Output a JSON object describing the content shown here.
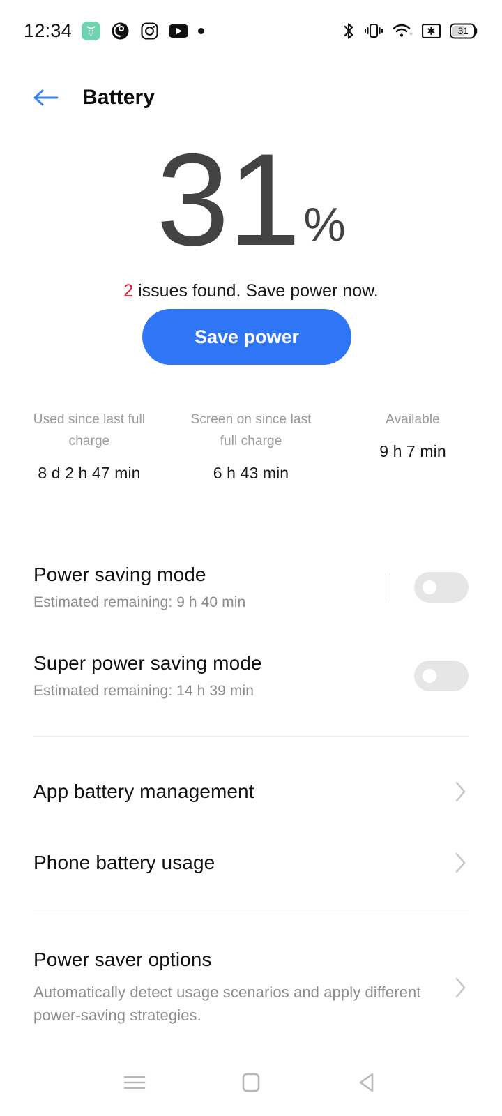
{
  "status_bar": {
    "time": "12:34",
    "left_icons": [
      "green-app-icon",
      "owl-app-icon",
      "instagram-icon",
      "youtube-icon",
      "notification-dot"
    ],
    "right_icons": [
      "bluetooth-icon",
      "vibrate-icon",
      "wifi-icon",
      "screenshot-icon",
      "battery-icon"
    ],
    "battery_level": "31"
  },
  "header": {
    "title": "Battery",
    "back_icon": "arrow-left-icon",
    "back_color": "#3b82f6"
  },
  "battery": {
    "percent": "31",
    "percent_sign": "%",
    "issues_count": "2",
    "issues_text": " issues found. Save power now.",
    "issues_count_color": "#e0203c",
    "save_button_label": "Save power",
    "save_button_color": "#2f76f6"
  },
  "stats": [
    {
      "label": "Used since last full charge",
      "value": "8 d 2 h 47 min"
    },
    {
      "label": "Screen on since last full charge",
      "value": "6 h 43 min"
    },
    {
      "label": "Available",
      "value": "9 h 7 min"
    }
  ],
  "toggles": [
    {
      "title": "Power saving mode",
      "subtitle": "Estimated remaining:  9 h 40 min",
      "state": "off",
      "has_divider": true
    },
    {
      "title": "Super power saving mode",
      "subtitle": "Estimated remaining:  14 h 39 min",
      "state": "off",
      "has_divider": false
    }
  ],
  "nav_items": [
    {
      "title": "App battery management",
      "chevron": "chevron-right-icon"
    },
    {
      "title": "Phone battery usage",
      "chevron": "chevron-right-icon"
    }
  ],
  "power_saver": {
    "title": "Power saver options",
    "subtitle": "Automatically detect usage scenarios and apply different power-saving strategies.",
    "chevron": "chevron-right-icon"
  },
  "system_nav": {
    "recents_icon": "menu-icon",
    "home_icon": "home-square-icon",
    "back_icon": "back-triangle-icon"
  }
}
